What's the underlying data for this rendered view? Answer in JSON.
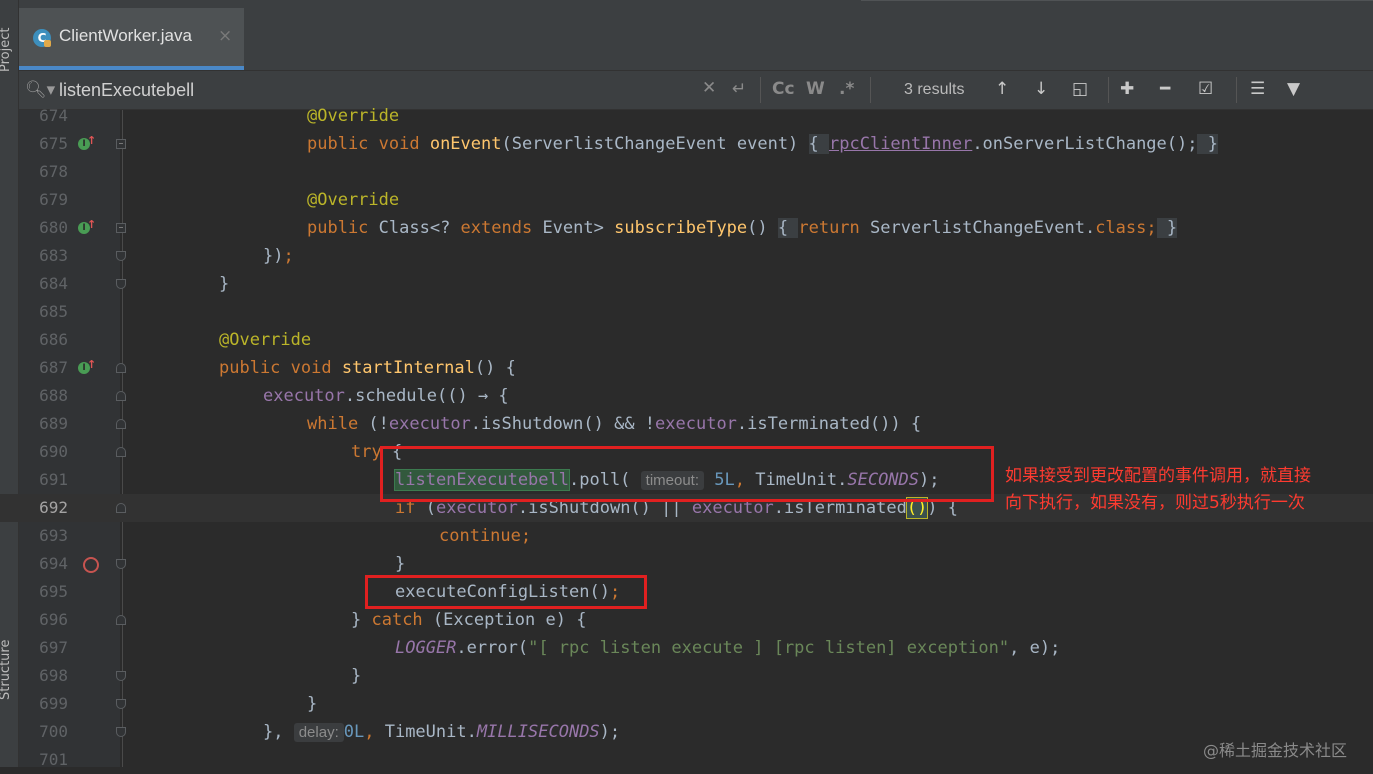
{
  "sidebar": {
    "project_label": "Project",
    "structure_label": "Structure"
  },
  "tab": {
    "icon_letter": "C",
    "title": "ClientWorker.java",
    "close": "×"
  },
  "search": {
    "query": "listenExecutebell",
    "match_case": "Cc",
    "words": "W",
    "regex": ".*",
    "results": "3 results"
  },
  "code_lines": [
    {
      "num": "674",
      "current": false
    },
    {
      "num": "675",
      "current": false
    },
    {
      "num": "678",
      "current": false
    },
    {
      "num": "679",
      "current": false
    },
    {
      "num": "680",
      "current": false
    },
    {
      "num": "683",
      "current": false
    },
    {
      "num": "684",
      "current": false
    },
    {
      "num": "685",
      "current": false
    },
    {
      "num": "686",
      "current": false
    },
    {
      "num": "687",
      "current": false
    },
    {
      "num": "688",
      "current": false
    },
    {
      "num": "689",
      "current": false
    },
    {
      "num": "690",
      "current": false
    },
    {
      "num": "691",
      "current": false
    },
    {
      "num": "692",
      "current": true
    },
    {
      "num": "693",
      "current": false
    },
    {
      "num": "694",
      "current": false
    },
    {
      "num": "695",
      "current": false
    },
    {
      "num": "696",
      "current": false
    },
    {
      "num": "697",
      "current": false
    },
    {
      "num": "698",
      "current": false
    },
    {
      "num": "699",
      "current": false
    },
    {
      "num": "700",
      "current": false
    },
    {
      "num": "701",
      "current": false
    }
  ],
  "code": {
    "l674": "@Override",
    "l675": {
      "kw1": "public void ",
      "fn": "onEvent",
      "p1": "(ServerlistChangeEvent event) ",
      "ob": "{ ",
      "fld": "rpcClientInner",
      "p2": ".onServerListChange();",
      "cb": " }"
    },
    "l679": "@Override",
    "l680": {
      "kw1": "public ",
      "p1": "Class<? ",
      "kw2": "extends ",
      "p2": "Event> ",
      "fn": "subscribeType",
      "p3": "() ",
      "ob": "{ ",
      "kw3": "return ",
      "p4": "ServerlistChangeEvent.",
      "kw4": "class",
      "p5": ";",
      "cb": " }"
    },
    "l683": {
      "p1": "})",
      "semi": ";"
    },
    "l684": "}",
    "l686": "@Override",
    "l687": {
      "kw1": "public void ",
      "fn": "startInternal",
      "p1": "() {"
    },
    "l688": {
      "fld": "executor",
      "p1": ".schedule(() → {"
    },
    "l689": {
      "kw1": "while ",
      "p1": "(!",
      "fld1": "executor",
      "p2": ".isShutdown() && !",
      "fld2": "executor",
      "p3": ".isTerminated()) {"
    },
    "l690": {
      "kw1": "try ",
      "p1": "{"
    },
    "l691": {
      "match": "listenExecutebell",
      "p1": ".poll( ",
      "hint": "timeout:",
      "num": "5L",
      "sep": ", ",
      "p2": "TimeUnit.",
      "cst": "SECONDS",
      "p3": ");"
    },
    "l692": {
      "kw1": "if ",
      "p1": "(",
      "fld1": "executor",
      "p2": ".isShutdown() || ",
      "fld2": "executor",
      "p3": ".isTerminated",
      "paren": "()",
      "p4": ") {"
    },
    "l693": {
      "kw1": "continue",
      "semi": ";"
    },
    "l694": "}",
    "l695": {
      "p1": "executeConfigListen()",
      "semi": ";"
    },
    "l696": {
      "p1": "} ",
      "kw1": "catch ",
      "p2": "(Exception e) {"
    },
    "l697": {
      "fld": "LOGGER",
      "p1": ".error(",
      "str": "\"[ rpc listen execute ] [rpc listen] exception\"",
      "p2": ", e);"
    },
    "l698": "}",
    "l699": "}",
    "l700": {
      "p1": "}, ",
      "hint": "delay:",
      "num": "0L",
      "sep": ", ",
      "p2": "TimeUnit.",
      "cst": "MILLISECONDS",
      "p3": ");"
    }
  },
  "annotation": {
    "line1": "如果接受到更改配置的事件调用，就直接",
    "line2": "向下执行，如果没有，则过5秒执行一次"
  },
  "watermark": "@稀土掘金技术社区",
  "colors": {
    "editor_bg": "#2b2b2b",
    "keyword": "#cc7832",
    "annotation_code": "#bbb529",
    "method": "#ffc66d",
    "field": "#9876aa",
    "number": "#6897bb",
    "string": "#6a8759",
    "highlight_box": "#e02020"
  }
}
